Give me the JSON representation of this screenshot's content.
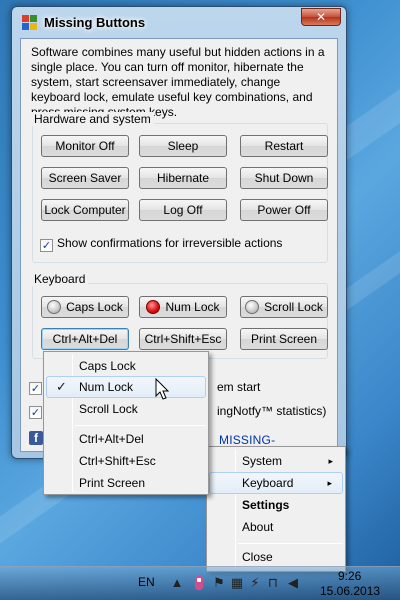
{
  "window": {
    "title": "Missing Buttons",
    "close_label": "✕",
    "description": "Software combines many useful but hidden actions in a single place. You can turn off monitor, hibernate the system, start screensaver immediately, change keyboard lock, emulate useful key combinations, and press missing system keys."
  },
  "hardware": {
    "group_label": "Hardware and system",
    "buttons": [
      "Monitor Off",
      "Sleep",
      "Restart",
      "Screen Saver",
      "Hibernate",
      "Shut Down",
      "Lock Computer",
      "Log Off",
      "Power Off"
    ],
    "confirm_label": "Show confirmations for irreversible actions",
    "confirm_checked": true
  },
  "keyboard": {
    "group_label": "Keyboard",
    "locks": [
      {
        "label": "Caps Lock",
        "on": false
      },
      {
        "label": "Num Lock",
        "on": true
      },
      {
        "label": "Scroll Lock",
        "on": false
      }
    ],
    "combos": [
      "Ctrl+Alt+Del",
      "Ctrl+Shift+Esc",
      "Print Screen"
    ]
  },
  "options": {
    "startup_tail": "em start",
    "stats_tail": "ingNotfy™ statistics)"
  },
  "footer": {
    "site_link": "MISSING-BUTTONS.COM",
    "fb_glyph": "f"
  },
  "keyboard_menu": {
    "items": [
      "Caps Lock",
      "Num Lock",
      "Scroll Lock",
      "Ctrl+Alt+Del",
      "Ctrl+Shift+Esc",
      "Print Screen"
    ],
    "checked_item": "Num Lock",
    "tick_glyph": "✓"
  },
  "tray_menu": {
    "items": [
      "System",
      "Keyboard",
      "Settings",
      "About",
      "Close"
    ],
    "arrow_glyph": "▸"
  },
  "taskbar": {
    "language": "EN",
    "time": "9:26",
    "date": "15.06.2013"
  }
}
